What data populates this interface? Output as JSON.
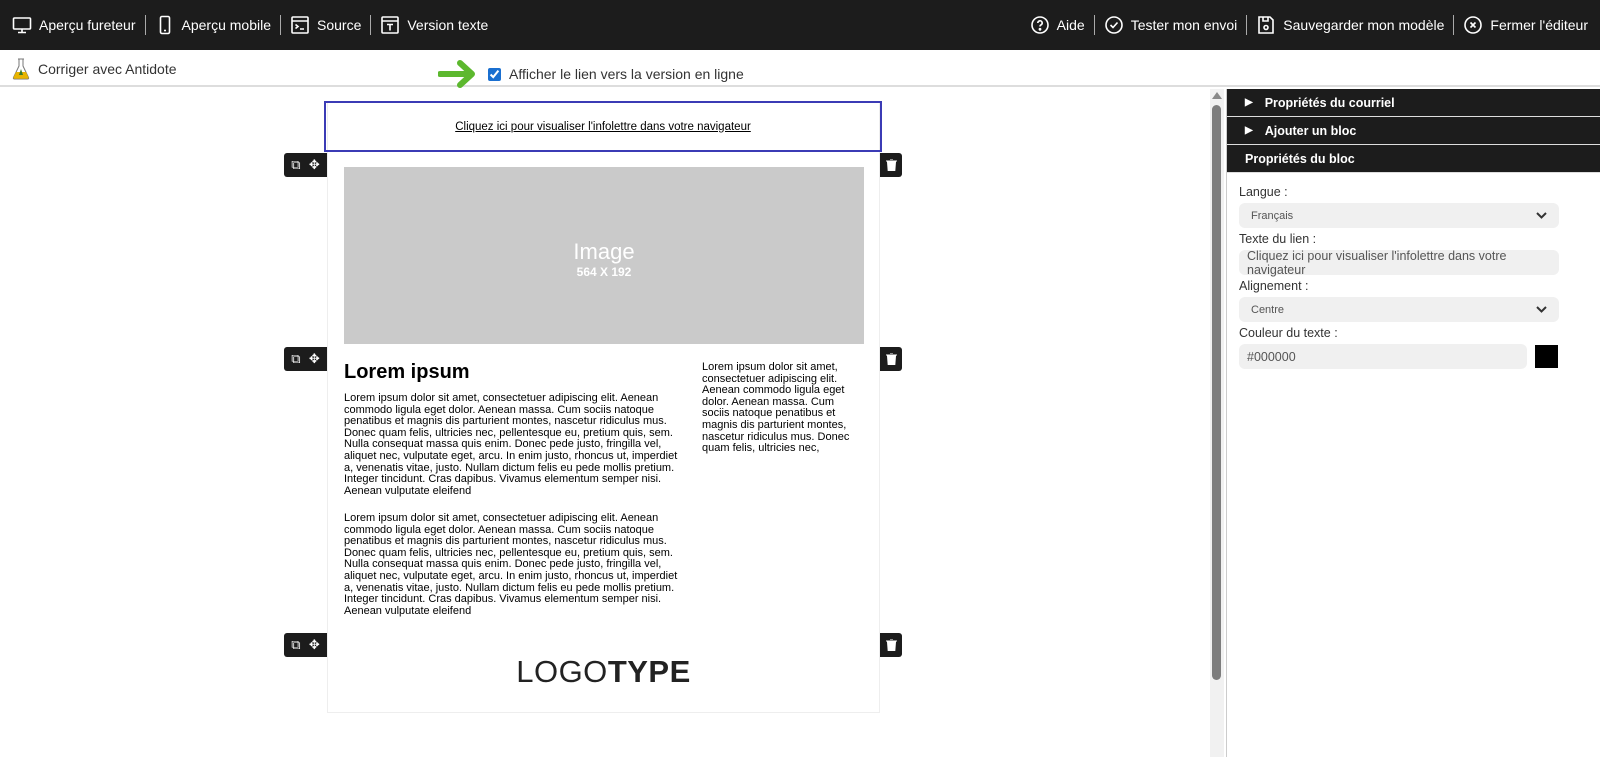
{
  "topbar": {
    "left": [
      {
        "label": "Aperçu fureteur",
        "icon": "monitor-icon"
      },
      {
        "label": "Aperçu mobile",
        "icon": "mobile-icon"
      },
      {
        "label": "Source",
        "icon": "terminal-icon"
      },
      {
        "label": "Version texte",
        "icon": "text-icon"
      }
    ],
    "right": [
      {
        "label": "Aide",
        "icon": "help-icon"
      },
      {
        "label": "Tester mon envoi",
        "icon": "check-circle-icon"
      },
      {
        "label": "Sauvegarder mon modèle",
        "icon": "save-icon"
      },
      {
        "label": "Fermer l'éditeur",
        "icon": "close-circle-icon"
      }
    ]
  },
  "toolbar2": {
    "antidote": "Corriger avec Antidote",
    "show_link": "Afficher le lien vers la version en ligne",
    "show_link_checked": true,
    "arrow_color": "#5cb82e"
  },
  "email": {
    "link_text": "Cliquez ici pour visualiser l'infolettre dans votre navigateur",
    "image_label": "Image",
    "image_size": "564 X 192",
    "heading": "Lorem ipsum",
    "para1": "Lorem ipsum dolor sit amet, consectetuer adipiscing elit. Aenean commodo ligula eget dolor. Aenean massa. Cum sociis natoque penatibus et magnis dis parturient montes, nascetur ridiculus mus. Donec quam felis, ultricies nec, pellentesque eu, pretium quis, sem. Nulla consequat massa quis enim. Donec pede justo, fringilla vel, aliquet nec, vulputate eget, arcu. In enim justo, rhoncus ut, imperdiet a, venenatis vitae, justo. Nullam dictum felis eu pede mollis pretium. Integer tincidunt. Cras dapibus. Vivamus elementum semper nisi. Aenean vulputate eleifend",
    "para2": "Lorem ipsum dolor sit amet, consectetuer adipiscing elit. Aenean commodo ligula eget dolor. Aenean massa. Cum sociis natoque penatibus et magnis dis parturient montes, nascetur ridiculus mus. Donec quam felis, ultricies nec, pellentesque eu, pretium quis, sem. Nulla consequat massa quis enim. Donec pede justo, fringilla vel, aliquet nec, vulputate eget, arcu. In enim justo, rhoncus ut, imperdiet a, venenatis vitae, justo. Nullam dictum felis eu pede mollis pretium. Integer tincidunt. Cras dapibus. Vivamus elementum semper nisi. Aenean vulputate eleifend",
    "right_col": "Lorem ipsum dolor sit amet, consectetuer adipiscing elit. Aenean commodo ligula eget dolor. Aenean massa. Cum sociis natoque penatibus et magnis dis parturient montes, nascetur ridiculus mus. Donec quam felis, ultricies nec,",
    "logo_light": "LOGO",
    "logo_bold": "TYPE",
    "selection_color": "#3b3bb5"
  },
  "panel": {
    "sections": [
      "Propriétés du courriel",
      "Ajouter un bloc",
      "Propriétés du bloc"
    ],
    "langue_label": "Langue :",
    "langue_value": "Français",
    "texte_label": "Texte du lien :",
    "texte_value": "Cliquez ici pour visualiser l'infolettre dans votre navigateur",
    "align_label": "Alignement :",
    "align_value": "Centre",
    "couleur_label": "Couleur du texte :",
    "couleur_value": "#000000"
  }
}
